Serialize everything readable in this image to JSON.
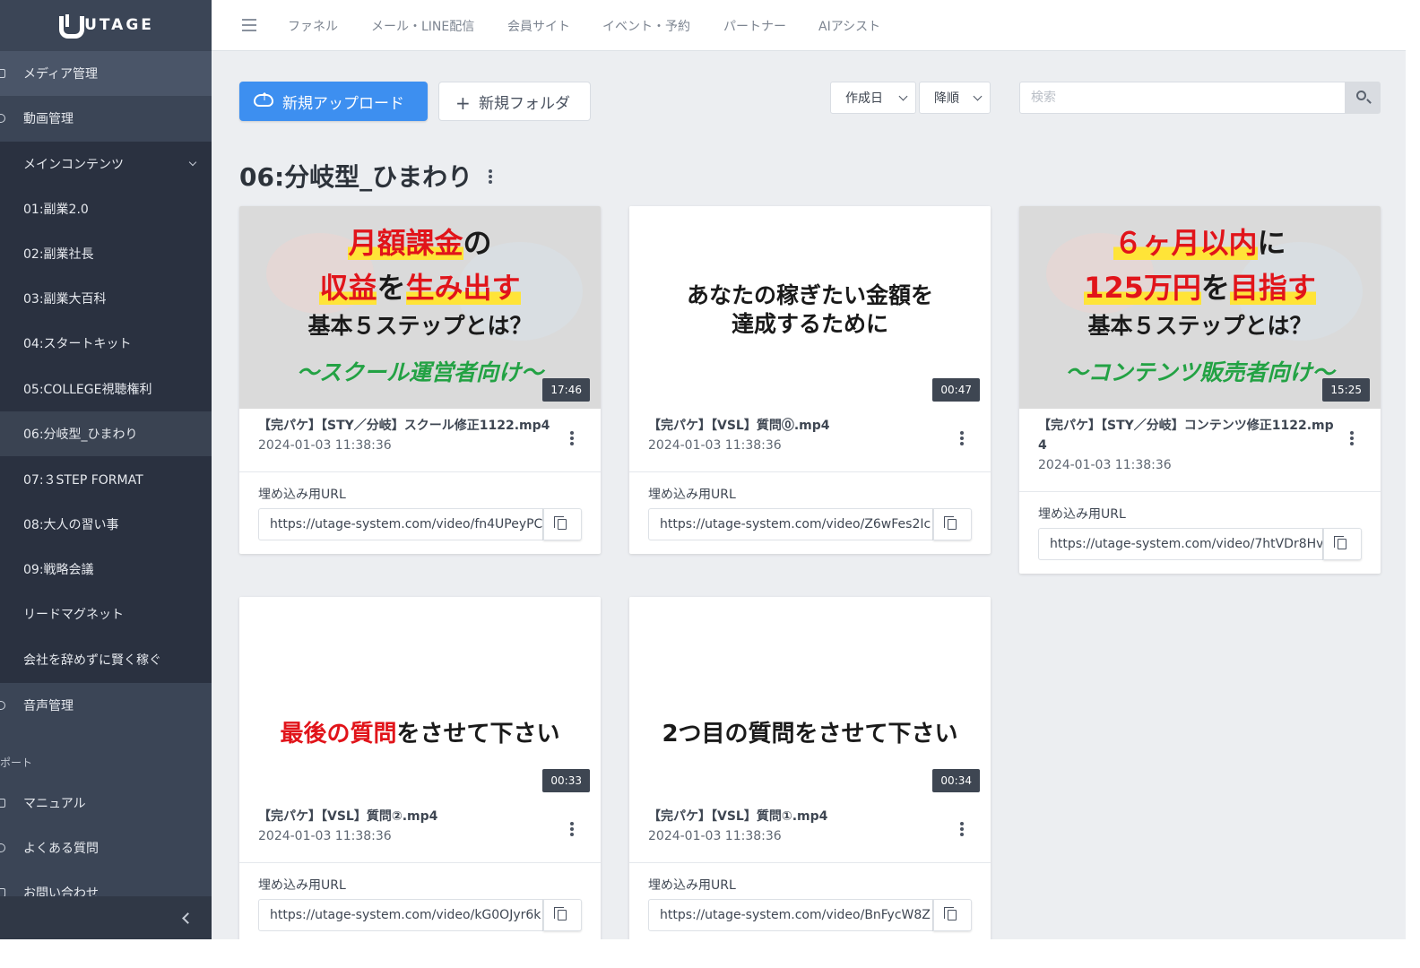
{
  "app": {
    "brand": "UTAGE"
  },
  "sidebar": {
    "items": [
      {
        "label": "メディア管理"
      },
      {
        "label": "動画管理"
      },
      {
        "label": "メインコンテンツ"
      },
      {
        "label": "音声管理"
      }
    ],
    "sub_items": [
      {
        "label": "01:副業2.0"
      },
      {
        "label": "02:副業社長"
      },
      {
        "label": "03:副業大百科"
      },
      {
        "label": "04:スタートキット"
      },
      {
        "label": "05:COLLEGE視聴権利"
      },
      {
        "label": "06:分岐型_ひまわり"
      },
      {
        "label": "07:３STEP FORMAT"
      },
      {
        "label": "08:大人の習い事"
      },
      {
        "label": "09:戦略会議"
      },
      {
        "label": "リードマグネット"
      },
      {
        "label": "会社を辞めずに賢く稼ぐ"
      }
    ],
    "support_label": "ポート",
    "support_items": [
      {
        "label": "マニュアル"
      },
      {
        "label": "よくある質問"
      },
      {
        "label": "お問い合わせ"
      }
    ]
  },
  "topnav": [
    "ファネル",
    "メール・LINE配信",
    "会員サイト",
    "イベント・予約",
    "パートナー",
    "AIアシスト"
  ],
  "toolbar": {
    "upload_label": "新規アップロード",
    "folder_label": "新規フォルダ",
    "sort_field": "作成日",
    "sort_order": "降順",
    "search_placeholder": "検索"
  },
  "folder": {
    "title": "06:分岐型_ひまわり"
  },
  "embed_label": "埋め込み用URL",
  "videos": [
    {
      "thumb_lines": [
        [
          {
            "t": "月額課金",
            "c": "red hl"
          },
          {
            "t": "の",
            "c": "dark"
          }
        ],
        [
          {
            "t": "収益",
            "c": "red hl"
          },
          {
            "t": "を",
            "c": "dark"
          },
          {
            "t": "生み出す",
            "c": "red hl"
          }
        ],
        [
          {
            "t": "基本５ステップとは？",
            "c": "dark"
          }
        ],
        [
          {
            "t": "～スクール運営者向け～",
            "c": "green"
          }
        ]
      ],
      "duration": "17:46",
      "filename": "【完パケ】【STY／分岐】スクール修正1122.mp4",
      "date": "2024-01-03 11:38:36",
      "url": "https://utage-system.com/video/fn4UPeyPC"
    },
    {
      "thumb_lines": [
        [
          {
            "t": "あなたの稼ぎたい金額を",
            "c": "dark"
          }
        ],
        [
          {
            "t": "達成するために",
            "c": "dark"
          }
        ]
      ],
      "duration": "00:47",
      "filename": "【完パケ】【VSL】質問⓪.mp4",
      "date": "2024-01-03 11:38:36",
      "url": "https://utage-system.com/video/Z6wFes2Ic"
    },
    {
      "thumb_lines": [
        [
          {
            "t": "６ヶ月以内",
            "c": "red hl"
          },
          {
            "t": "に",
            "c": "dark"
          }
        ],
        [
          {
            "t": "125万円",
            "c": "red hl"
          },
          {
            "t": "を",
            "c": "dark"
          },
          {
            "t": "目指す",
            "c": "red hl"
          }
        ],
        [
          {
            "t": "基本５ステップとは？",
            "c": "dark"
          }
        ],
        [
          {
            "t": "～コンテンツ販売者向け～",
            "c": "green"
          }
        ]
      ],
      "duration": "15:25",
      "filename": "【完パケ】【STY／分岐】コンテンツ修正1122.mp4",
      "date": "2024-01-03 11:38:36",
      "url": "https://utage-system.com/video/7htVDr8Hv"
    },
    {
      "thumb_lines": [
        [
          {
            "t": "最後の質問",
            "c": "red"
          },
          {
            "t": "をさせて下さい",
            "c": "dark"
          }
        ]
      ],
      "duration": "00:33",
      "filename": "【完パケ】【VSL】質問②.mp4",
      "date": "2024-01-03 11:38:36",
      "url": "https://utage-system.com/video/kG0OJyr6k"
    },
    {
      "thumb_lines": [
        [
          {
            "t": "2つ目の質問をさせて下さい",
            "c": "dark"
          }
        ]
      ],
      "duration": "00:34",
      "filename": "【完パケ】【VSL】質問①.mp4",
      "date": "2024-01-03 11:38:36",
      "url": "https://utage-system.com/video/BnFycW8Z"
    }
  ]
}
